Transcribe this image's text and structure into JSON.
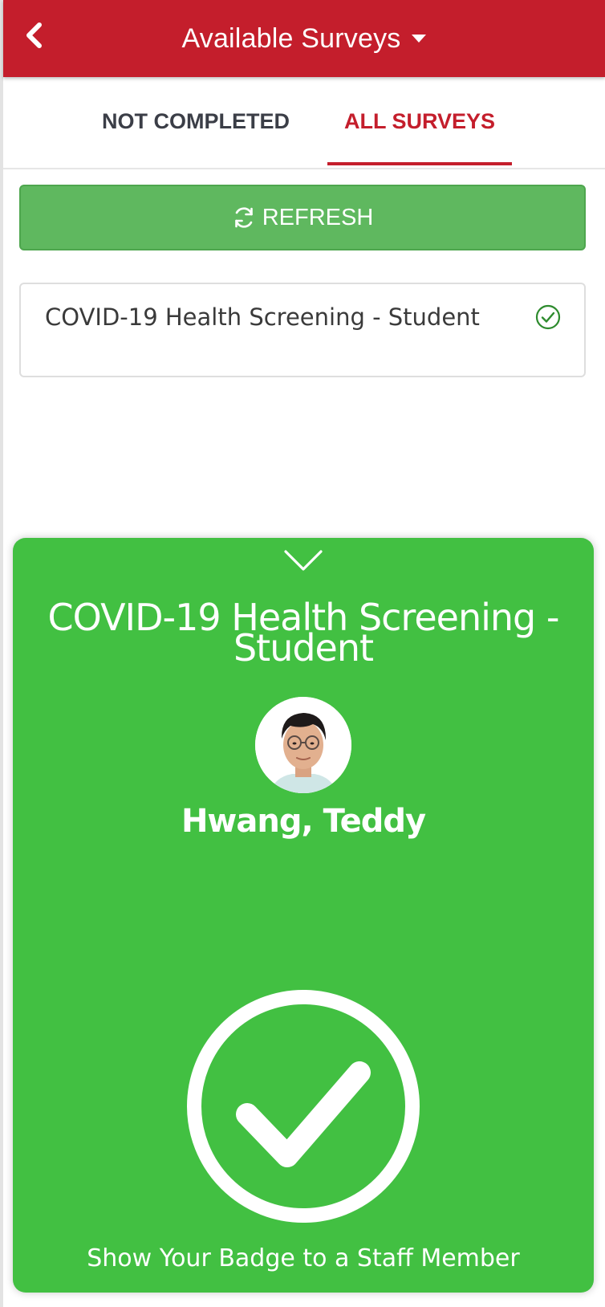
{
  "header": {
    "title": "Available Surveys",
    "back_icon": "chevron-left-icon",
    "dropdown_icon": "caret-down-icon"
  },
  "tabs": [
    {
      "label": "NOT COMPLETED",
      "active": false
    },
    {
      "label": "ALL SURVEYS",
      "active": true
    }
  ],
  "refresh": {
    "label": "REFRESH",
    "icon": "refresh-icon"
  },
  "surveys": [
    {
      "name": "COVID-19 Health Screening - Student",
      "status_icon": "check-circle-icon",
      "completed": true
    }
  ],
  "badge": {
    "title_line1": "COVID-19 Health Screening -",
    "title_line2": "Student",
    "student_name": "Hwang, Teddy",
    "instruction": "Show Your Badge to a Staff Member",
    "collapse_icon": "chevron-down-icon",
    "status_icon": "large-check-circle-icon"
  },
  "colors": {
    "header_red": "#c41e2c",
    "refresh_green": "#5fb85f",
    "badge_green": "#42c042",
    "check_green": "#2e8b2e"
  }
}
